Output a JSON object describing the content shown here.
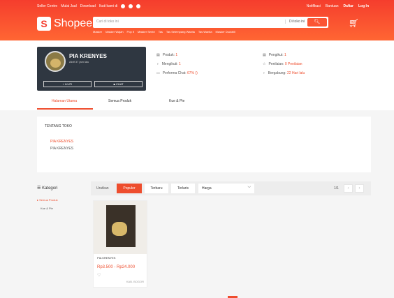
{
  "topbar": {
    "left_links": [
      "Seller Centre",
      "Mulai Jual",
      "Download",
      "Ikuti kami di"
    ],
    "right_links": [
      "Notifikasi",
      "Bantuan",
      "Daftar",
      "Log In"
    ]
  },
  "header": {
    "logo_text": "Shopee",
    "search_placeholder": "Cari di toko ini",
    "search_scope": "Di toko ini",
    "hints": [
      "Masker",
      "Masker Wajah",
      "Pop It",
      "Masker Sentri",
      "Tas",
      "Tas Selempang Wanita",
      "Tas Wanita",
      "Masker Duckbill"
    ]
  },
  "shop": {
    "name": "PIA KRENYES",
    "active": "Aktif 37 jam lalu",
    "follow_label": "IKUTI",
    "chat_label": "CHAT"
  },
  "stats": {
    "products_label": "Produk:",
    "products": "1",
    "following_label": "Mengikuti:",
    "following": "1",
    "chat_perf_label": "Performa Chat:",
    "chat_perf": "67% ()",
    "followers_label": "Pengikut:",
    "followers": "1",
    "rating_label": "Penilaian:",
    "rating": "0 Penilaian",
    "joined_label": "Bergabung:",
    "joined": "22 Hari lalu"
  },
  "tabs": [
    "Halaman Utama",
    "Semua Produk",
    "Kue & Pie"
  ],
  "about": {
    "title": "TENTANG TOKO",
    "line1": "PIA KRENYES",
    "line2": "PIA KRENYES"
  },
  "category": {
    "title": "Kategori",
    "items": [
      "Semua Produk",
      "Kue & Pie"
    ]
  },
  "sort": {
    "label": "Urutkan",
    "buttons": [
      "Populer",
      "Terbaru",
      "Terlaris"
    ],
    "price_label": "Harga",
    "page": "1/1",
    "prev": "‹",
    "next": "›"
  },
  "product": {
    "name": "PIA KRENYES",
    "price": "Rp3.500 - Rp24.000",
    "location": "KAB. BOGOR"
  }
}
